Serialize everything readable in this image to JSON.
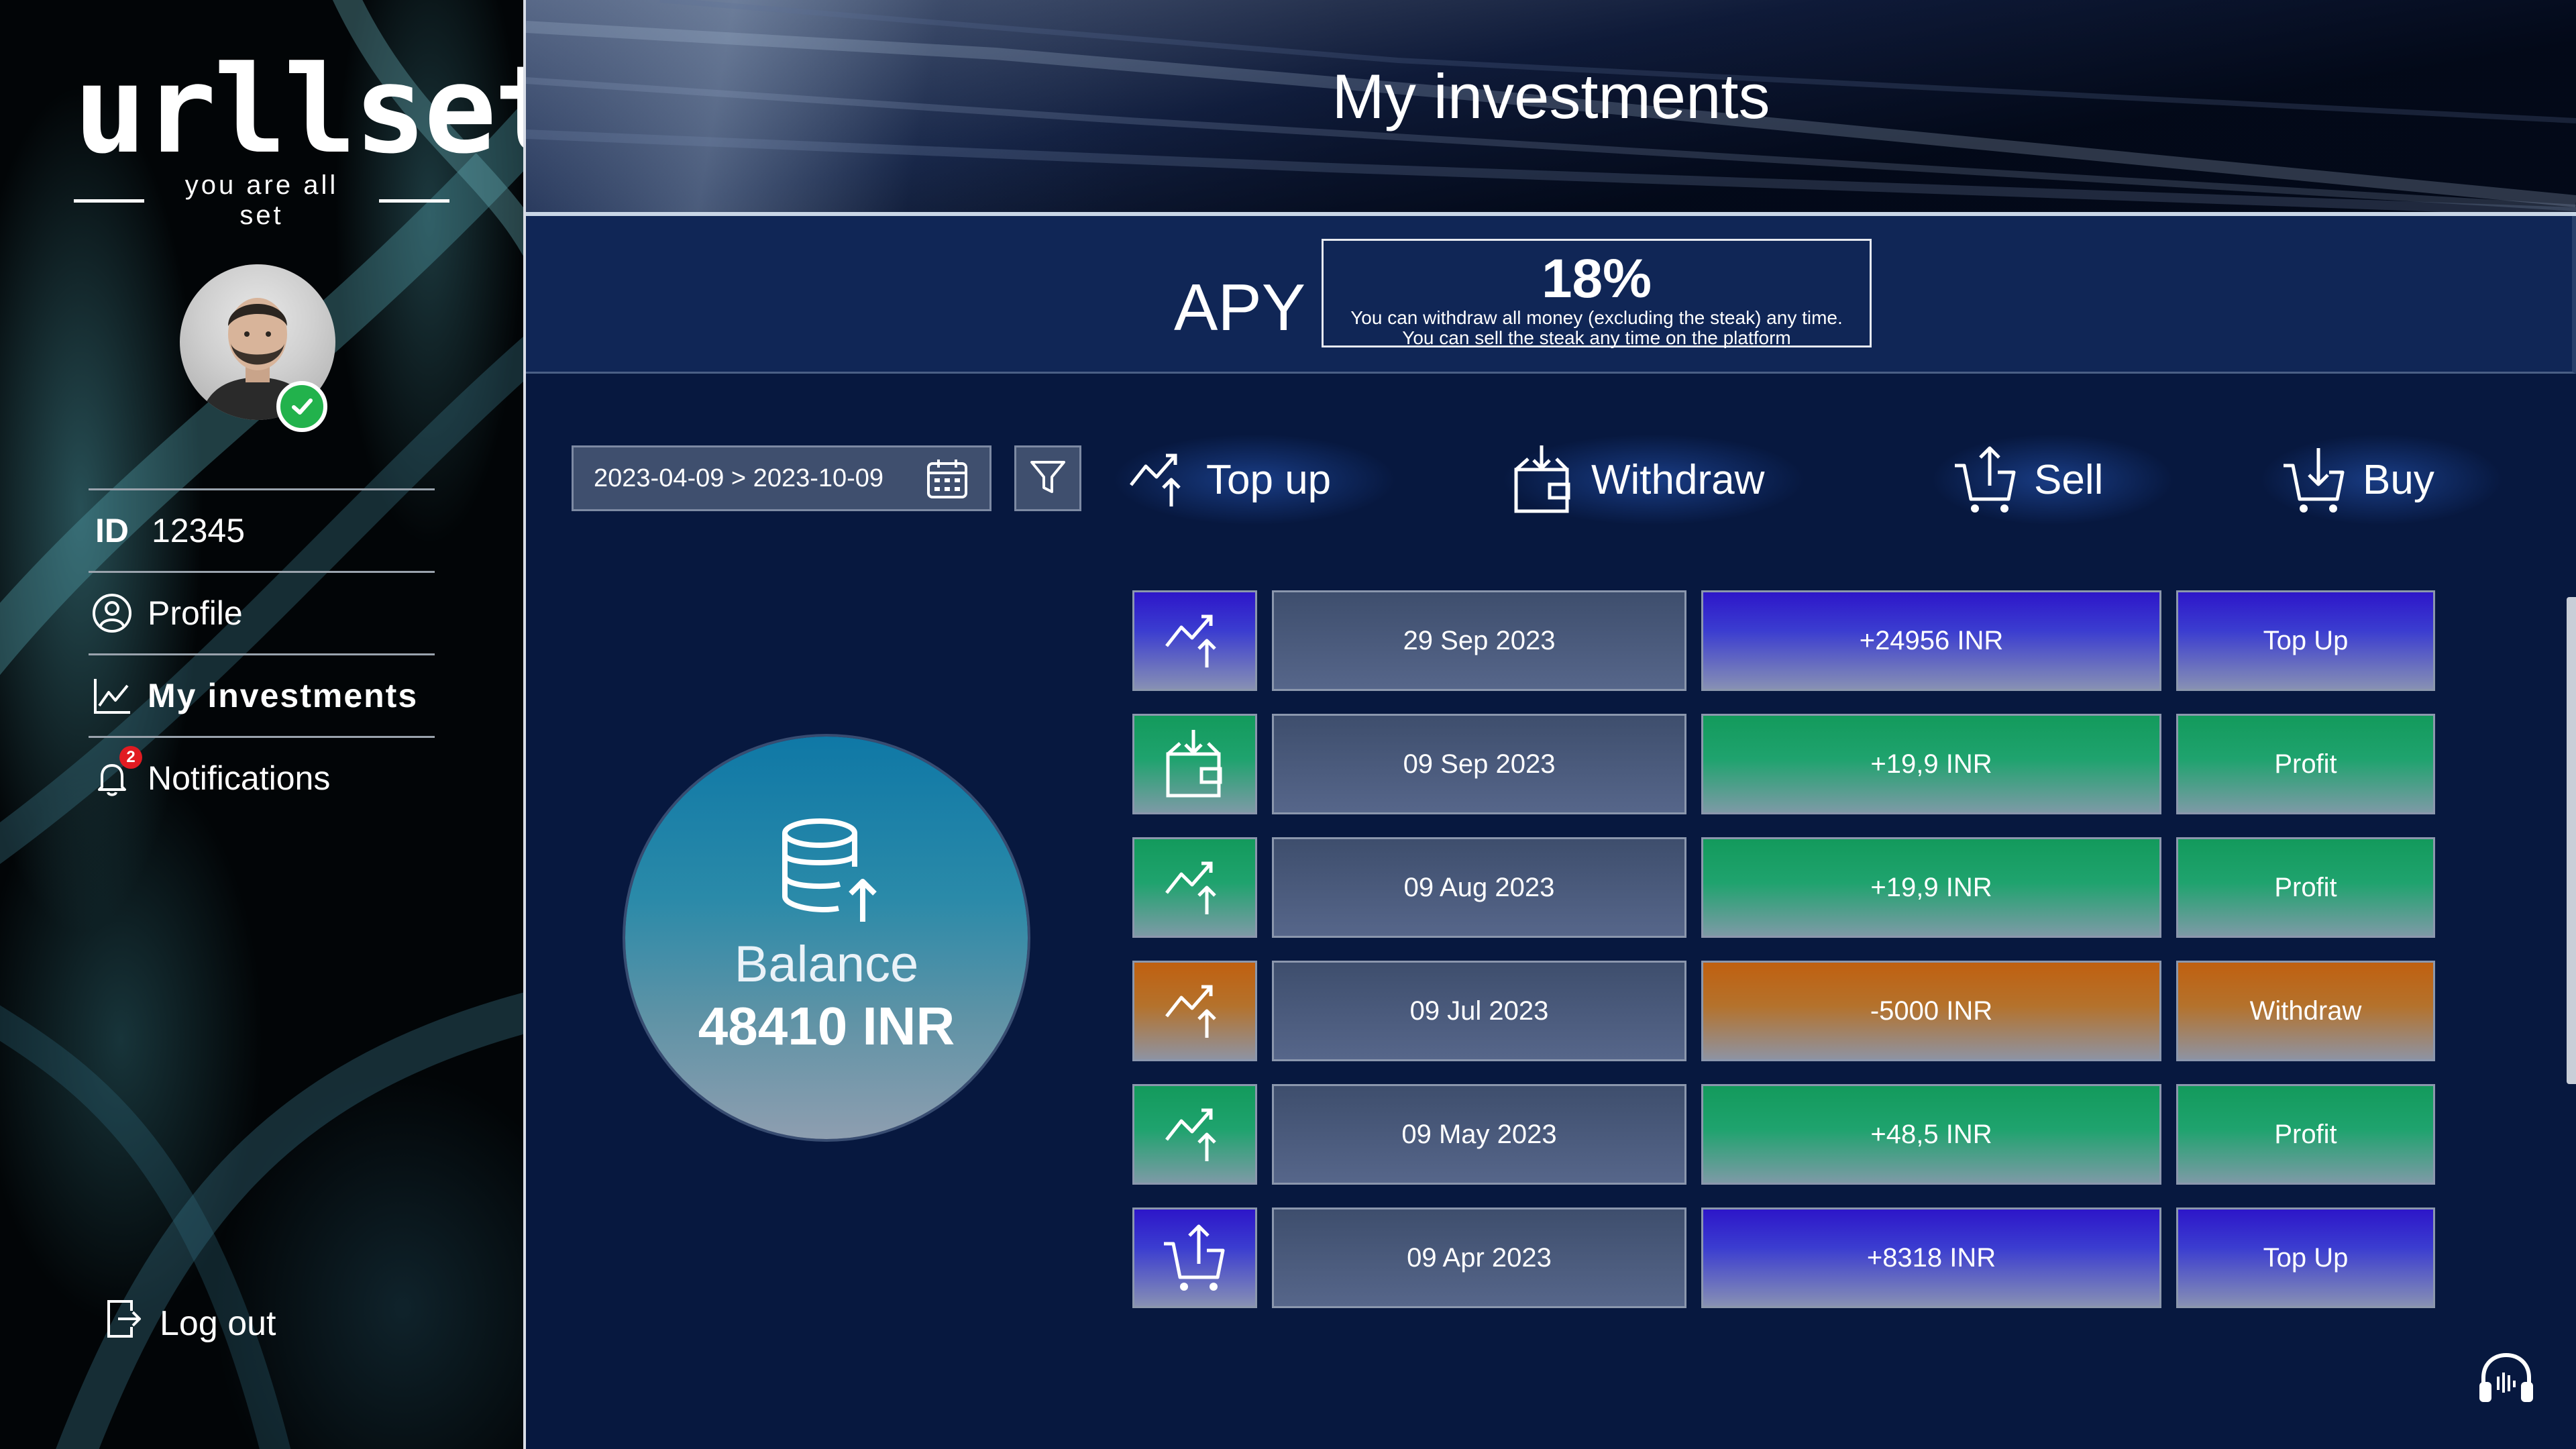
{
  "brand": {
    "name": "urllset",
    "tagline": "you are all set"
  },
  "user": {
    "id_label": "ID",
    "id_value": "12345",
    "verified": true
  },
  "sidebar": {
    "items": [
      {
        "label": "Profile",
        "icon": "user-circle-icon"
      },
      {
        "label": "My investments",
        "icon": "chart-line-icon",
        "active": true
      },
      {
        "label": "Notifications",
        "icon": "bell-icon",
        "badge": "2"
      }
    ],
    "logout": "Log out"
  },
  "header": {
    "title": "My investments"
  },
  "apy": {
    "label": "APY",
    "rate": "18%",
    "note_line1": "You can withdraw all money (excluding the steak) any time.",
    "note_line2": "You can sell the steak any time on the platform"
  },
  "toolbar": {
    "date_range": "2023-04-09 > 2023-10-09",
    "actions": [
      {
        "label": "Top up",
        "icon": "trend-up-icon"
      },
      {
        "label": "Withdraw",
        "icon": "wallet-download-icon"
      },
      {
        "label": "Sell",
        "icon": "cart-upload-icon"
      },
      {
        "label": "Buy",
        "icon": "cart-download-icon"
      }
    ]
  },
  "balance": {
    "label": "Balance",
    "value": "48410 INR"
  },
  "transactions": [
    {
      "icon": "trend-up-icon",
      "date": "29 Sep 2023",
      "amount": "+24956 INR",
      "type": "Top Up",
      "color": "#2d16c9"
    },
    {
      "icon": "wallet-download-icon",
      "date": "09 Sep 2023",
      "amount": "+19,9 INR",
      "type": "Profit",
      "color": "#139a5c"
    },
    {
      "icon": "trend-up-icon",
      "date": "09 Aug 2023",
      "amount": "+19,9 INR",
      "type": "Profit",
      "color": "#139a5c"
    },
    {
      "icon": "trend-up-icon",
      "date": "09 Jul 2023",
      "amount": "-5000 INR",
      "type": "Withdraw",
      "color": "#c06010"
    },
    {
      "icon": "trend-up-icon",
      "date": "09 May 2023",
      "amount": "+48,5 INR",
      "type": "Profit",
      "color": "#139a5c"
    },
    {
      "icon": "cart-upload-icon",
      "date": "09 Apr 2023",
      "amount": "+8318 INR",
      "type": "Top Up",
      "color": "#2d16c9"
    }
  ],
  "colors": {
    "background": "#07183f",
    "apy_band": "#102656",
    "green": "#22b24c",
    "alert_red": "#e11b22"
  }
}
